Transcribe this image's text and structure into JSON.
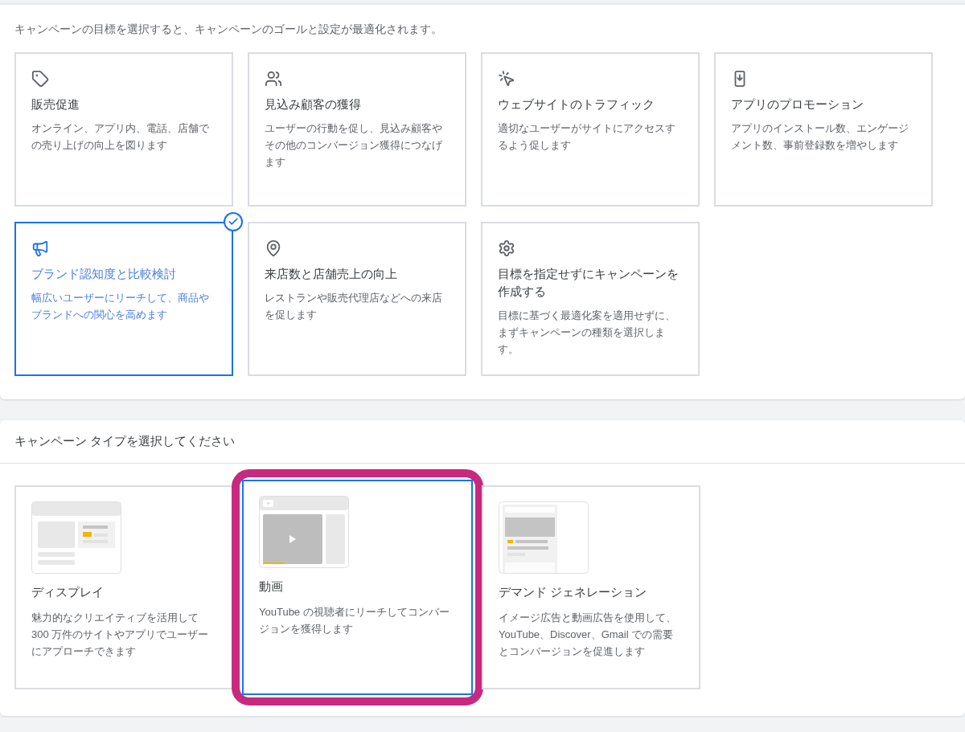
{
  "goal_section": {
    "intro": "キャンペーンの目標を選択すると、キャンペーンのゴールと設定が最適化されます。",
    "goals": [
      {
        "kind": "tag",
        "title": "販売促進",
        "description": "オンライン、アプリ内、電話、店舗での売り上げの向上を図ります",
        "selected": false
      },
      {
        "kind": "people",
        "title": "見込み顧客の獲得",
        "description": "ユーザーの行動を促し、見込み顧客やその他のコンバージョン獲得につなげます",
        "selected": false
      },
      {
        "kind": "click",
        "title": "ウェブサイトのトラフィック",
        "description": "適切なユーザーがサイトにアクセスするよう促します",
        "selected": false
      },
      {
        "kind": "app",
        "title": "アプリのプロモーション",
        "description": "アプリのインストール数、エンゲージメント数、事前登録数を増やします",
        "selected": false
      },
      {
        "kind": "megaphone",
        "title": "ブランド認知度と比較検討",
        "description": "幅広いユーザーにリーチして、商品やブランドへの関心を高めます",
        "selected": true
      },
      {
        "kind": "pin",
        "title": "来店数と店舗売上の向上",
        "description": "レストランや販売代理店などへの来店を促します",
        "selected": false
      },
      {
        "kind": "gear",
        "title": "目標を指定せずにキャンペーンを作成する",
        "description": "目標に基づく最適化案を適用せずに、まずキャンペーンの種類を選択します。",
        "selected": false
      }
    ]
  },
  "type_section": {
    "heading": "キャンペーン タイプを選択してください",
    "types": [
      {
        "kind": "display",
        "title": "ディスプレイ",
        "description": "魅力的なクリエイティブを活用して 300 万件のサイトやアプリでユーザーにアプローチできます",
        "selected": false,
        "highlighted": false
      },
      {
        "kind": "video",
        "title": "動画",
        "description": "YouTube の視聴者にリーチしてコンバージョンを獲得します",
        "selected": true,
        "highlighted": true
      },
      {
        "kind": "demand",
        "title": "デマンド ジェネレーション",
        "description": "イメージ広告と動画広告を使用して、YouTube、Discover、Gmail での需要とコンバージョンを促進します",
        "selected": false,
        "highlighted": false
      }
    ]
  }
}
